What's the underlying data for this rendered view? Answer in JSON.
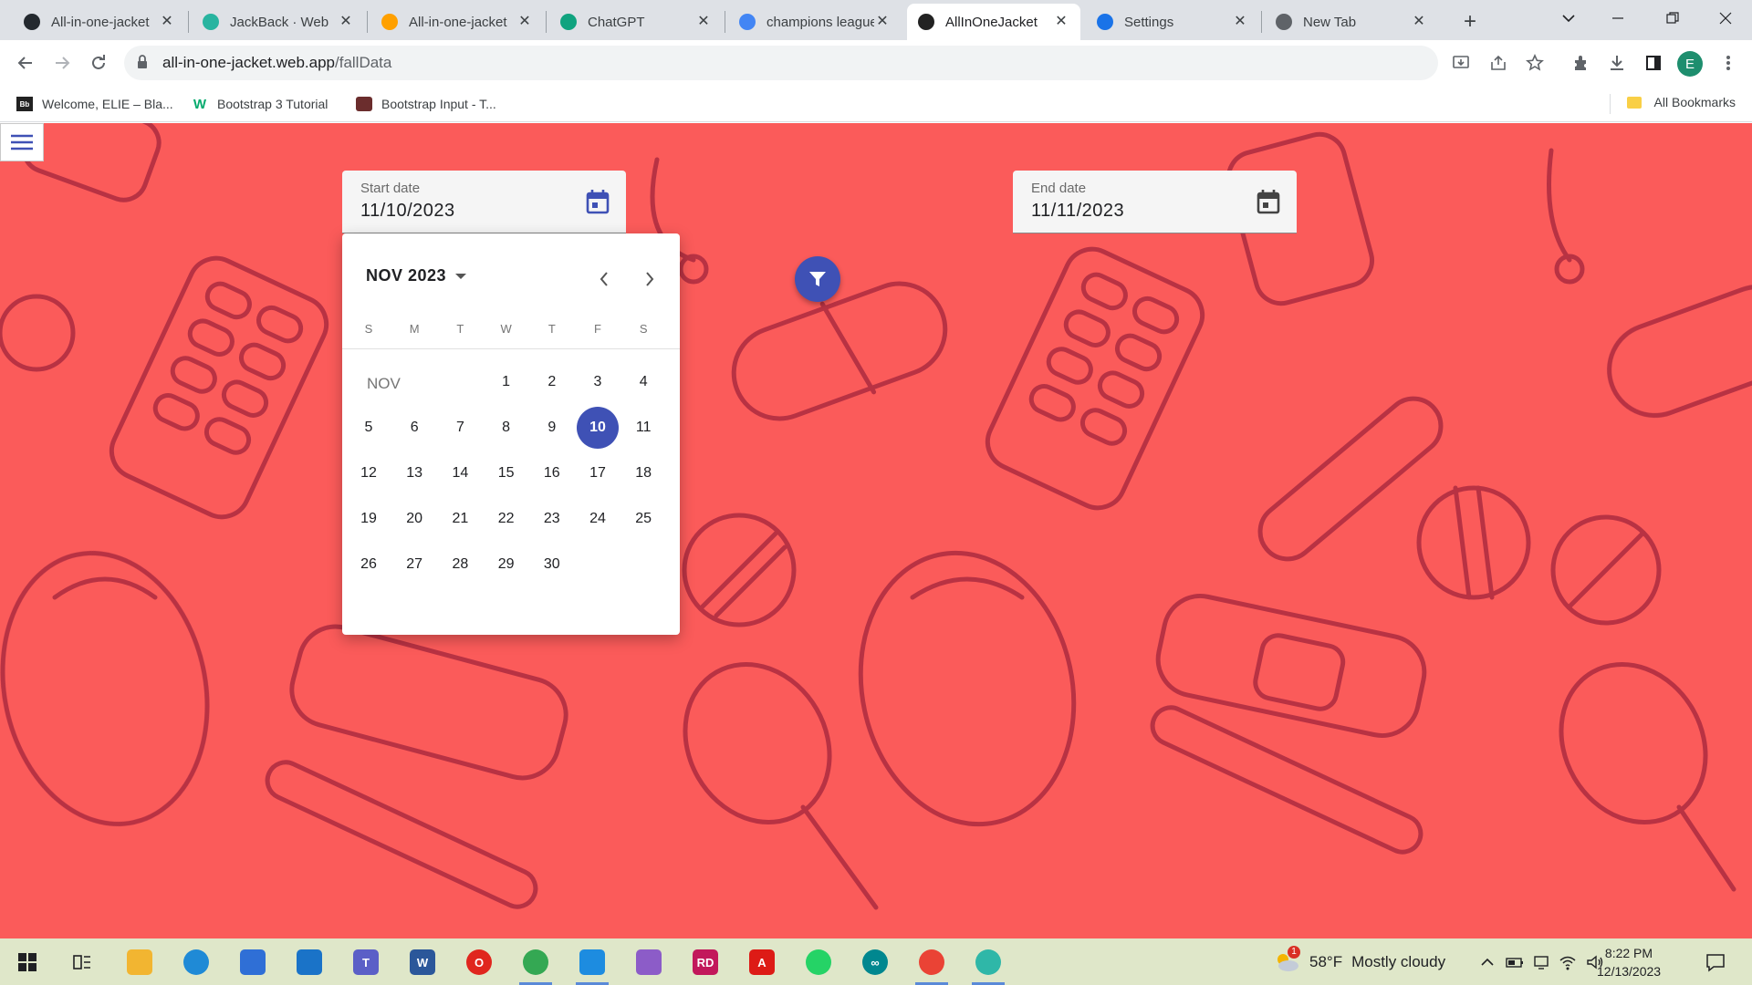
{
  "browser": {
    "tabs": [
      {
        "title": "All-in-one-jacket",
        "icon": "github-icon",
        "color": "#24292f",
        "active": false
      },
      {
        "title": "JackBack · Web",
        "icon": "page-icon",
        "color": "#28b4a0",
        "active": false
      },
      {
        "title": "All-in-one-jacket",
        "icon": "firebase-icon",
        "color": "#ffa000",
        "active": false
      },
      {
        "title": "ChatGPT",
        "icon": "chatgpt-icon",
        "color": "#10a37f",
        "active": false
      },
      {
        "title": "champions league",
        "icon": "google-icon",
        "color": "#4285f4",
        "active": false
      },
      {
        "title": "AllInOneJacket",
        "icon": "angular-icon",
        "color": "#222222",
        "active": true
      },
      {
        "title": "Settings",
        "icon": "gear-icon",
        "color": "#1a73e8",
        "active": false
      },
      {
        "title": "New Tab",
        "icon": "chrome-icon",
        "color": "#5f6368",
        "active": false
      }
    ],
    "url_host": "all-in-one-jacket.web.app",
    "url_path": "/fallData",
    "profile_initial": "E",
    "bookmarks": [
      {
        "label": "Welcome, ELIE – Bla...",
        "icon": "blackboard-icon"
      },
      {
        "label": "Bootstrap 3 Tutorial",
        "icon": "w3schools-icon"
      },
      {
        "label": "Bootstrap Input - T...",
        "icon": "tutorialspoint-icon"
      }
    ],
    "all_bookmarks_label": "All Bookmarks"
  },
  "page": {
    "background_color": "#fb5b5a",
    "start_date": {
      "label": "Start date",
      "value": "11/10/2023"
    },
    "end_date": {
      "label": "End date",
      "value": "11/11/2023"
    },
    "accent_color": "#3f51b5"
  },
  "datepicker": {
    "period_label": "NOV 2023",
    "month_label": "NOV",
    "weekdays": [
      "S",
      "M",
      "T",
      "W",
      "T",
      "F",
      "S"
    ],
    "first_weekday_index": 3,
    "days_in_month": 30,
    "selected_day": 10
  },
  "taskbar": {
    "weather_badge": "1",
    "temperature": "58°F",
    "weather": "Mostly cloudy",
    "time": "8:22 PM",
    "date": "12/13/2023"
  }
}
